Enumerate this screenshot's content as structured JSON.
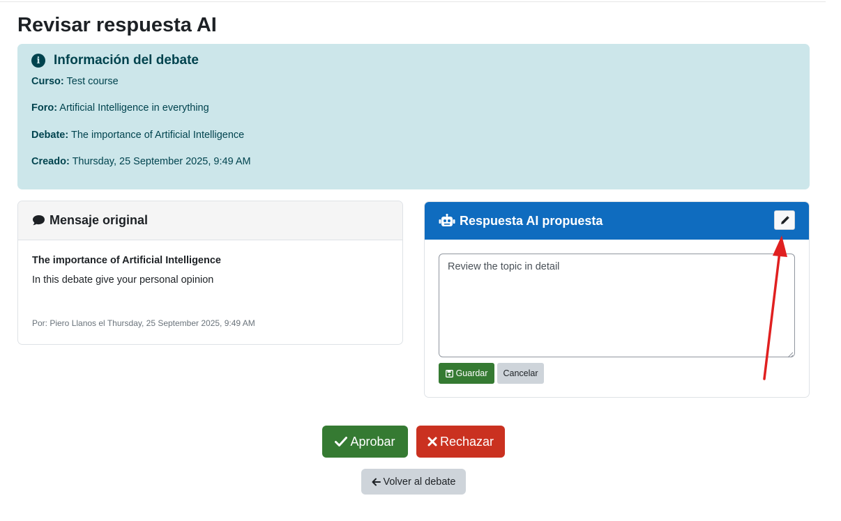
{
  "page": {
    "title": "Revisar respuesta AI"
  },
  "info": {
    "title": "Información del debate",
    "icon": "info-circle-icon",
    "course_label": "Curso:",
    "course_value": "Test course",
    "forum_label": "Foro:",
    "forum_value": "Artificial Intelligence in everything",
    "debate_label": "Debate:",
    "debate_value": "The importance of Artificial Intelligence",
    "created_label": "Creado:",
    "created_value": "Thursday, 25 September 2025, 9:49 AM"
  },
  "original": {
    "title": "Mensaje original",
    "icon": "comment-icon",
    "subject": "The importance of Artificial Intelligence",
    "body": "In this debate give your personal opinion",
    "meta": "Por: Piero Llanos el Thursday, 25 September 2025, 9:49 AM"
  },
  "proposed": {
    "title": "Respuesta AI propuesta",
    "icon": "robot-icon",
    "edit_icon": "pencil-icon",
    "reply_text": "Review the topic in detail",
    "save_label": "Guardar",
    "cancel_label": "Cancelar"
  },
  "actions": {
    "approve_label": "Aprobar",
    "reject_label": "Rechazar",
    "back_label": "Volver al debate"
  },
  "colors": {
    "info_bg": "#cce6ea",
    "primary": "#0f6cbf",
    "success": "#357a32",
    "danger": "#ca3120",
    "secondary": "#ced4da",
    "annotation": "#e02020"
  }
}
